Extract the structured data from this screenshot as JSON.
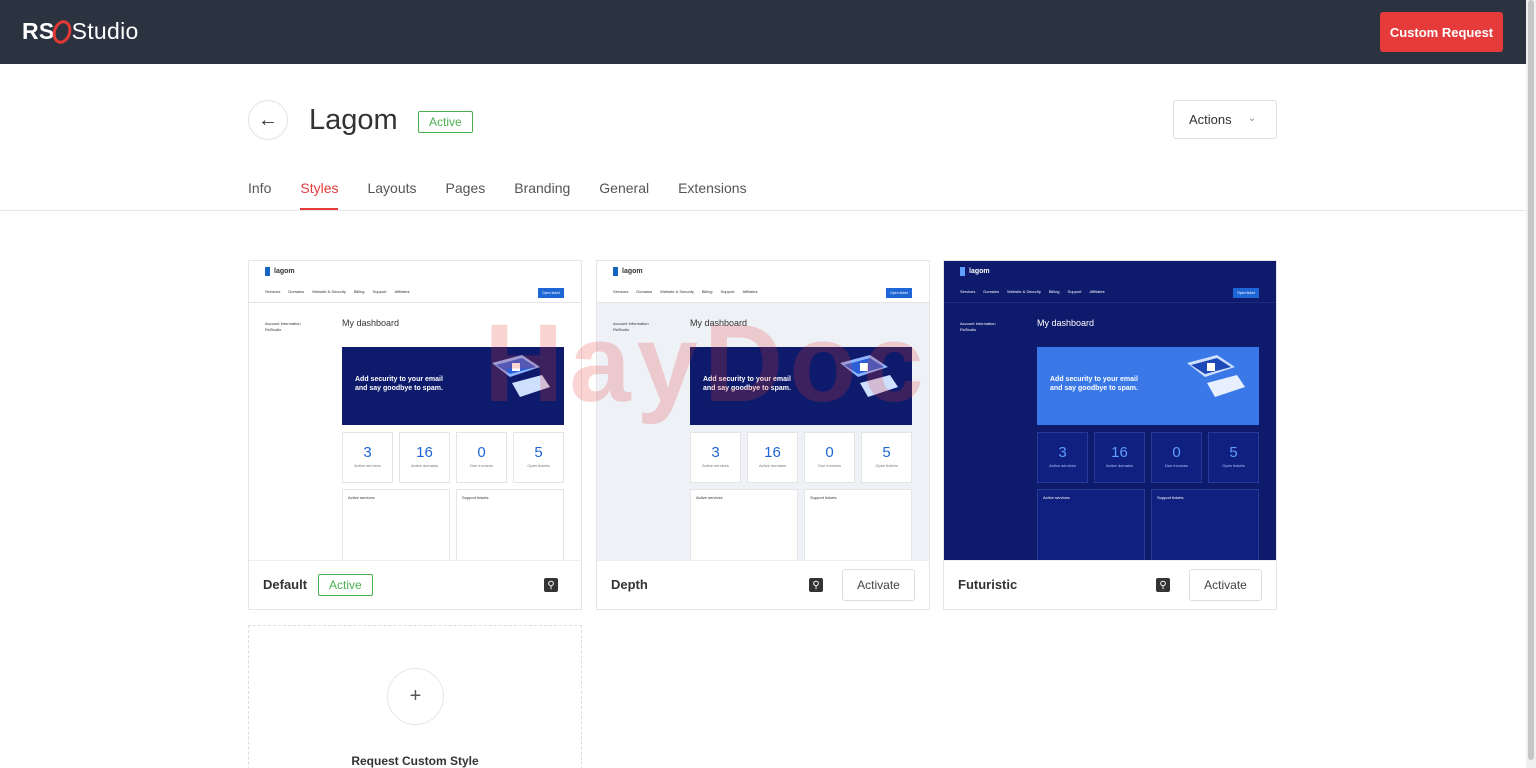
{
  "brand": {
    "logo_left": "RS",
    "logo_right": "Studio"
  },
  "header": {
    "custom_request_label": "Custom Request"
  },
  "page": {
    "title": "Lagom",
    "status": "Active",
    "actions_label": "Actions"
  },
  "tabs": [
    {
      "label": "Info"
    },
    {
      "label": "Styles"
    },
    {
      "label": "Layouts"
    },
    {
      "label": "Pages"
    },
    {
      "label": "Branding"
    },
    {
      "label": "General"
    },
    {
      "label": "Extensions"
    }
  ],
  "active_tab": "Styles",
  "styles": [
    {
      "name": "Default",
      "state": "Active",
      "theme": "light"
    },
    {
      "name": "Depth",
      "state": "Activate",
      "theme": "depth"
    },
    {
      "name": "Futuristic",
      "state": "Activate",
      "theme": "dark"
    }
  ],
  "preview": {
    "logo": "lagom",
    "nav": [
      "Services",
      "Domains",
      "Website & Security",
      "Billing",
      "Support",
      "Affiliates"
    ],
    "order_button": "Open ticket",
    "account_title": "Account Information",
    "company": "RsStudio",
    "dashboard_title": "My dashboard",
    "hero_text_1": "Add security to your email",
    "hero_text_2": "and say goodbye to spam.",
    "stats": [
      {
        "value": "3",
        "label": "Active services"
      },
      {
        "value": "16",
        "label": "Active domains"
      },
      {
        "value": "0",
        "label": "Due invoices"
      },
      {
        "value": "5",
        "label": "Open tickets"
      }
    ],
    "panel_services": "Active services",
    "panel_tickets": "Support tickets"
  },
  "add_style": {
    "label": "Request Custom Style"
  },
  "watermark": "HayDoc",
  "colors": {
    "accent": "#e53b3b",
    "topbar": "#2b3340",
    "active_green": "#4caf50",
    "link_blue": "#1e66d6"
  }
}
